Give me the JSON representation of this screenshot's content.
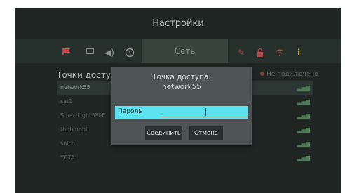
{
  "header": {
    "title": "Настройки"
  },
  "toolbar": {
    "active_tab_label": "Сеть",
    "icons": [
      "flag-icon",
      "monitor-icon",
      "volume-icon",
      "clock-icon",
      "network-tab",
      "pencil-icon",
      "lock-icon",
      "wifi-icon",
      "info-icon"
    ]
  },
  "access_points": {
    "title": "Точки доступа",
    "status": "Не подключено",
    "items": [
      {
        "name": "network55"
      },
      {
        "name": "sat1"
      },
      {
        "name": "SmartLight Wi-F"
      },
      {
        "name": "thobmobil"
      },
      {
        "name": "snich"
      },
      {
        "name": "YOTA"
      }
    ]
  },
  "dialog": {
    "title_line1": "Точка доступа:",
    "title_line2": "network55",
    "password_label": "Пароль",
    "password_value": "",
    "connect_label": "Соединить",
    "cancel_label": "Отмена"
  },
  "colors": {
    "screen_bg": "#1f2623",
    "dialog_bg": "#4e5353",
    "highlight": "#5de2f0",
    "button_bg": "#2a2f2f"
  }
}
